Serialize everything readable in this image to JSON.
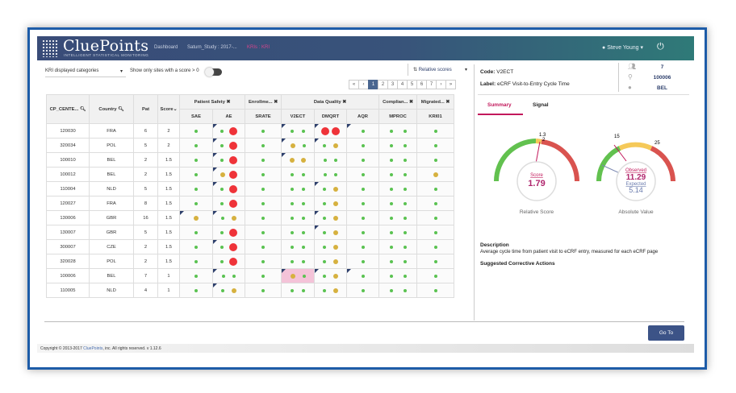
{
  "header": {
    "logo": "CluePoints",
    "logo_sub": "INTELLIGENT STATISTICAL MONITORING",
    "breadcrumbs": [
      "Dashboard",
      "Saturn_Study : 2017-...",
      "KRIs : KRI"
    ],
    "user": "Steve Young",
    "colors": {
      "accent": "#c2185b",
      "nav": "#394c78"
    }
  },
  "controls": {
    "categories": "KRI displayed categories",
    "toggle_label": "Show only sites with a score > 0",
    "toggle_on": false,
    "sort": "Relative scores",
    "pages": [
      "«",
      "‹",
      "1",
      "2",
      "3",
      "4",
      "5",
      "6",
      "7",
      "›",
      "»"
    ],
    "active_page": "1"
  },
  "table": {
    "headers": [
      "CP_CENTE...",
      "Country",
      "Pat",
      "Score"
    ],
    "groups": [
      {
        "label": "Patient Safety",
        "span": 2
      },
      {
        "label": "Enrollme...",
        "span": 1
      },
      {
        "label": "Data Quality",
        "span": 3
      },
      {
        "label": "Complian...",
        "span": 1
      },
      {
        "label": "Migrated...",
        "span": 1
      }
    ],
    "kris": [
      "SAE",
      "AE",
      "SRATE",
      "V2ECT",
      "DMQRT",
      "AQR",
      "MPROC",
      "KRI01"
    ],
    "rows": [
      {
        "site": "120030",
        "country": "FRA",
        "pat": "6",
        "score": "2",
        "cells": [
          "g",
          "^g r",
          "g",
          "^g g",
          "^r r",
          "^g",
          "g g",
          "g"
        ]
      },
      {
        "site": "320034",
        "country": "POL",
        "pat": "5",
        "score": "2",
        "cells": [
          "g",
          "^g r",
          "g",
          "^y g",
          "^g y",
          "g",
          "g g",
          "g"
        ]
      },
      {
        "site": "100010",
        "country": "BEL",
        "pat": "2",
        "score": "1.5",
        "cells": [
          "g",
          "^g r",
          "g",
          "^y y",
          "g g",
          "g",
          "g g",
          "g"
        ]
      },
      {
        "site": "100012",
        "country": "BEL",
        "pat": "2",
        "score": "1.5",
        "cells": [
          "g",
          "^y r",
          "g",
          "g g",
          "g g",
          "g",
          "g g",
          "y"
        ]
      },
      {
        "site": "110004",
        "country": "NLD",
        "pat": "5",
        "score": "1.5",
        "cells": [
          "g",
          "^g r",
          "g",
          "g g",
          "^g y",
          "g",
          "g g",
          "g"
        ]
      },
      {
        "site": "120027",
        "country": "FRA",
        "pat": "8",
        "score": "1.5",
        "cells": [
          "g",
          "g r",
          "g",
          "g g",
          "g y",
          "g",
          "g g",
          "g"
        ]
      },
      {
        "site": "130006",
        "country": "GBR",
        "pat": "16",
        "score": "1.5",
        "cells": [
          "^y",
          "^g y",
          "g",
          "g g",
          "^g y",
          "g",
          "g g",
          "g"
        ]
      },
      {
        "site": "130007",
        "country": "GBR",
        "pat": "5",
        "score": "1.5",
        "cells": [
          "g",
          "g r",
          "g",
          "g g",
          "^g y",
          "g",
          "g g",
          "g"
        ]
      },
      {
        "site": "300007",
        "country": "CZE",
        "pat": "2",
        "score": "1.5",
        "cells": [
          "g",
          "^g r",
          "g",
          "g g",
          "g y",
          "g",
          "g g",
          "g"
        ]
      },
      {
        "site": "320028",
        "country": "POL",
        "pat": "2",
        "score": "1.5",
        "cells": [
          "g",
          "g r",
          "g",
          "g g",
          "g y",
          "g",
          "g g",
          "g"
        ]
      },
      {
        "site": "100006",
        "country": "BEL",
        "pat": "7",
        "score": "1",
        "cells": [
          "g",
          "^g g",
          "g",
          "^y g",
          "^g y",
          "^g",
          "g g",
          "g"
        ],
        "selected_kri": "V2ECT"
      },
      {
        "site": "110005",
        "country": "NLD",
        "pat": "4",
        "score": "1",
        "cells": [
          "g",
          "^g y",
          "g",
          "g g",
          "g y",
          "g",
          "g g",
          "g"
        ]
      }
    ]
  },
  "detail": {
    "code_label": "Code:",
    "code": "V2ECT",
    "label_label": "Label:",
    "label": "eCRF Visit-to-Entry Cycle Time",
    "patients": "7",
    "site": "100006",
    "country": "BEL",
    "tabs": [
      "Summary",
      "Signal"
    ],
    "active_tab": "Summary",
    "relative": {
      "title": "Relative Score",
      "score_label": "Score",
      "score": "1.79",
      "thresholds": [
        "1.3",
        "2"
      ],
      "range": [
        0,
        3
      ]
    },
    "absolute": {
      "title": "Absolute Value",
      "observed_label": "Observed",
      "observed": "11.29",
      "expected_label": "Expected",
      "expected": "5.14",
      "thresholds": [
        "15",
        "25"
      ],
      "range": [
        0,
        30
      ]
    },
    "description_title": "Description",
    "description": "Average cycle time from patient visit to eCRF entry, measured for each eCRF page",
    "actions_title": "Suggested Corrective Actions"
  },
  "footer": {
    "goto": "Go To",
    "copyright_pre": "Copyright © 2013-2017 ",
    "copyright_brand": "CluePoints",
    "copyright_post": ", inc. All rights reserved. v 1.12.6"
  }
}
